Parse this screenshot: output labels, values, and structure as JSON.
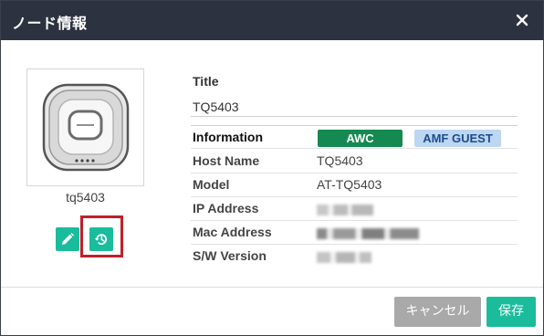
{
  "dialog": {
    "title": "ノード情報",
    "close_icon": "close-icon"
  },
  "device": {
    "image": "access-point-image",
    "name": "tq5403",
    "edit_icon": "pencil-icon",
    "history_icon": "history-icon"
  },
  "info": {
    "title_label": "Title",
    "title_value": "TQ5403",
    "section_label": "Information",
    "badges": [
      "AWC",
      "AMF GUEST"
    ],
    "rows": [
      {
        "label": "Host Name",
        "value": "TQ5403"
      },
      {
        "label": "Model",
        "value": "AT-TQ5403"
      },
      {
        "label": "IP Address",
        "value": ""
      },
      {
        "label": "Mac Address",
        "value": ""
      },
      {
        "label": "S/W Version",
        "value": ""
      }
    ]
  },
  "footer": {
    "cancel_label": "キャンセル",
    "save_label": "保存"
  },
  "colors": {
    "titlebar": "#2d3240",
    "accent": "#1abc9c",
    "awc_badge": "#148a52",
    "amf_badge": "#bcd6f3",
    "highlight": "#c0202a",
    "cancel": "#a9a9a9"
  }
}
